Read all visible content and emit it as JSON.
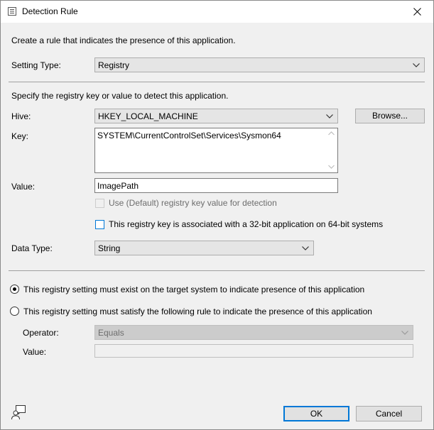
{
  "window": {
    "title": "Detection Rule"
  },
  "intro": "Create a rule that indicates the presence of this application.",
  "setting_type": {
    "label": "Setting Type:",
    "value": "Registry"
  },
  "registry_intro": "Specify the registry key or value to detect this application.",
  "hive": {
    "label": "Hive:",
    "value": "HKEY_LOCAL_MACHINE",
    "browse_label": "Browse..."
  },
  "key": {
    "label": "Key:",
    "value": "SYSTEM\\CurrentControlSet\\Services\\Sysmon64"
  },
  "value": {
    "label": "Value:",
    "value": "ImagePath"
  },
  "use_default": {
    "label": "Use (Default) registry key value for detection",
    "checked": false,
    "enabled": false
  },
  "is32bit": {
    "label": "This registry key is associated with a 32-bit application on 64-bit systems",
    "checked": false
  },
  "data_type": {
    "label": "Data Type:",
    "value": "String"
  },
  "radio_exist": {
    "label": "This registry setting must exist on the target system to indicate presence of this application",
    "selected": true
  },
  "radio_rule": {
    "label": "This registry setting must satisfy the following rule to indicate the presence of this application",
    "selected": false
  },
  "operator": {
    "label": "Operator:",
    "value": "Equals"
  },
  "rule_value": {
    "label": "Value:",
    "value": ""
  },
  "buttons": {
    "ok": "OK",
    "cancel": "Cancel"
  },
  "colors": {
    "accent": "#0078d7",
    "window_bg": "#f0f0f0",
    "titlebar_bg": "#ffffff"
  }
}
